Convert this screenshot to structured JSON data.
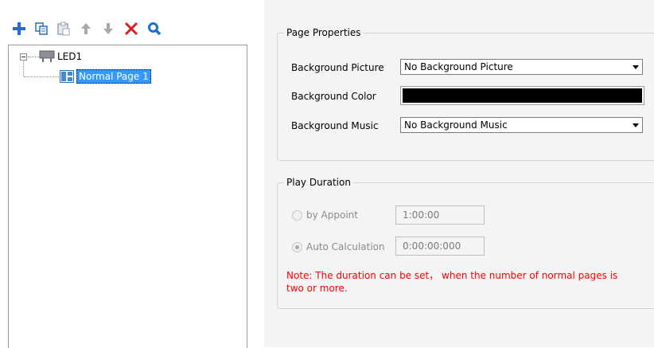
{
  "toolbar": {
    "buttons": [
      {
        "name": "add-icon",
        "color": "#1e6fd0"
      },
      {
        "name": "copy-icon",
        "color": "#2a6fb8"
      },
      {
        "name": "paste-icon",
        "color": "#9aa5b1"
      },
      {
        "name": "move-up-icon",
        "color": "#a9a9a9"
      },
      {
        "name": "move-down-icon",
        "color": "#a9a9a9"
      },
      {
        "name": "delete-icon",
        "color": "#d42020"
      },
      {
        "name": "search-icon",
        "color": "#1e6fd0"
      }
    ]
  },
  "tree": {
    "root_label": "LED1",
    "child_label": "Normal Page 1",
    "selection_color": "#3399ff"
  },
  "page_properties": {
    "legend": "Page Properties",
    "background_picture_label": "Background Picture",
    "background_picture_value": "No Background Picture",
    "background_color_label": "Background Color",
    "background_color_value": "#000000",
    "background_music_label": "Background Music",
    "background_music_value": "No Background Music"
  },
  "play_duration": {
    "legend": "Play Duration",
    "by_appoint_label": "by Appoint",
    "by_appoint_value": "1:00:00",
    "auto_calc_label": "Auto Calculation",
    "auto_calc_value": "0:00:00:000",
    "note_line1": "Note: The duration can be set， when the number of normal pages is",
    "note_line2": "two or more.",
    "note_color": "#ff0000"
  }
}
